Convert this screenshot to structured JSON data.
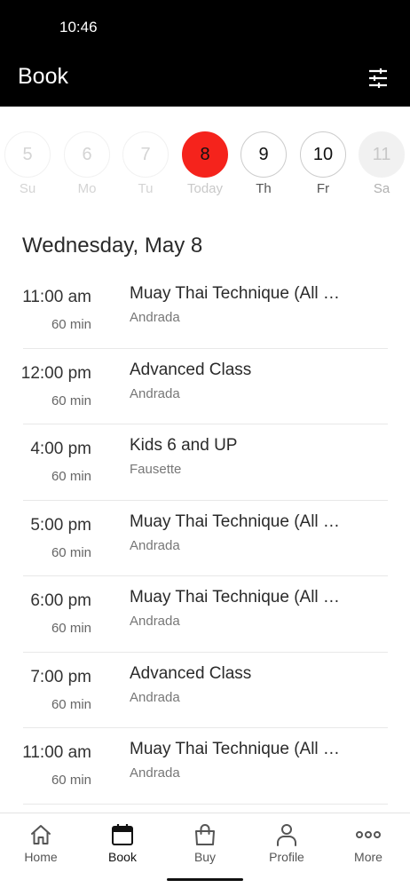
{
  "status_bar": {
    "time": "10:46"
  },
  "header": {
    "title": "Book",
    "filter_icon": "sliders-icon"
  },
  "week": [
    {
      "number": "5",
      "label": "Su",
      "state": "past"
    },
    {
      "number": "6",
      "label": "Mo",
      "state": "past"
    },
    {
      "number": "7",
      "label": "Tu",
      "state": "past"
    },
    {
      "number": "8",
      "label": "Today",
      "state": "selected"
    },
    {
      "number": "9",
      "label": "Th",
      "state": "default"
    },
    {
      "number": "10",
      "label": "Fr",
      "state": "default"
    },
    {
      "number": "11",
      "label": "Sa",
      "state": "disabled"
    }
  ],
  "date_heading": "Wednesday, May 8",
  "classes": [
    {
      "time": "11:00 am",
      "duration": "60 min",
      "name": "Muay Thai Technique (All Levels)",
      "instructor": "Andrada"
    },
    {
      "time": "12:00 pm",
      "duration": "60 min",
      "name": "Advanced Class",
      "instructor": "Andrada"
    },
    {
      "time": "4:00 pm",
      "duration": "60 min",
      "name": "Kids 6 and UP",
      "instructor": "Fausette"
    },
    {
      "time": "5:00 pm",
      "duration": "60 min",
      "name": "Muay Thai Technique (All Levels)",
      "instructor": "Andrada"
    },
    {
      "time": "6:00 pm",
      "duration": "60 min",
      "name": "Muay Thai Technique (All Levels)",
      "instructor": "Andrada"
    },
    {
      "time": "7:00 pm",
      "duration": "60 min",
      "name": "Advanced Class",
      "instructor": "Andrada"
    },
    {
      "time": "11:00 am",
      "duration": "60 min",
      "name": "Muay Thai Technique (All Levels)",
      "instructor": "Andrada"
    }
  ],
  "nav": [
    {
      "label": "Home",
      "icon": "home-icon",
      "active": false
    },
    {
      "label": "Book",
      "icon": "calendar-icon",
      "active": true
    },
    {
      "label": "Buy",
      "icon": "shopping-bag-icon",
      "active": false
    },
    {
      "label": "Profile",
      "icon": "person-icon",
      "active": false
    },
    {
      "label": "More",
      "icon": "more-dots-icon",
      "active": false
    }
  ],
  "colors": {
    "accent": "#f5231c",
    "header_bg": "#000000"
  }
}
